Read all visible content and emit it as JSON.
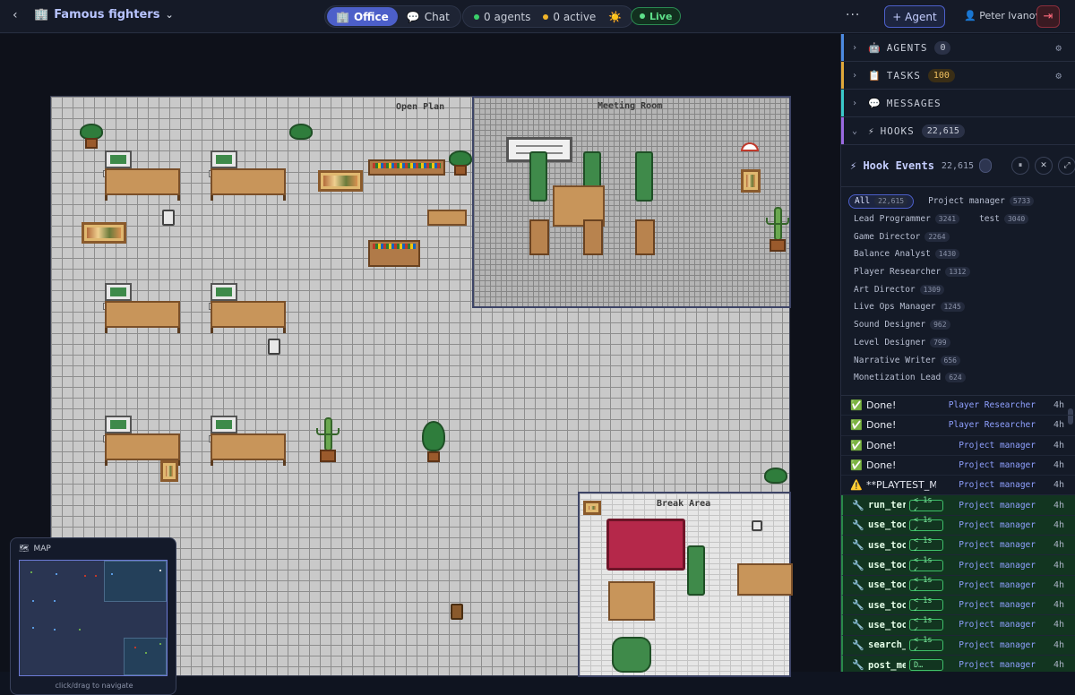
{
  "header": {
    "back_icon": "‹",
    "project_icon": "🏢",
    "project_title": "Famous fighters",
    "modes": [
      {
        "icon": "🏢",
        "label": "Office",
        "active": true
      },
      {
        "icon": "💬",
        "label": "Chat",
        "active": false
      }
    ],
    "agents_stat": "0 agents",
    "active_stat": "0 active",
    "weather_icon": "☀️",
    "live_label": "Live",
    "more_icon": "···",
    "add_agent_label": "+ Agent",
    "user_icon": "👤",
    "user_name": "Peter Ivanov",
    "logout_icon": "⇥"
  },
  "office": {
    "rooms": {
      "open_plan": "Open Plan",
      "meeting": "Meeting Room",
      "break": "Break Area"
    }
  },
  "minimap": {
    "icon": "🗺",
    "title": "MAP",
    "hint": "click/drag to navigate"
  },
  "sidebar": {
    "sections": [
      {
        "icon": "🤖",
        "label": "AGENTS",
        "count": "0",
        "color": "#4c8ae0",
        "gear": true
      },
      {
        "icon": "📋",
        "label": "TASKS",
        "count": "100",
        "color": "#e0a83a",
        "gear": true
      },
      {
        "icon": "💬",
        "label": "MESSAGES",
        "count": "",
        "color": "#3ac9c9",
        "gear": false
      },
      {
        "icon": "⚡",
        "label": "HOOKS",
        "count": "22,615",
        "color": "#9a6ae0",
        "gear": false
      }
    ],
    "hook_events": {
      "title": "⚡ Hook Events",
      "count": "22,615",
      "pause_icon": "⏸",
      "close_icon": "✕",
      "expand_icon": "⤢"
    },
    "filters": [
      [
        {
          "label": "All",
          "count": "22,615",
          "active": true
        },
        {
          "label": "Project manager",
          "count": "5733"
        }
      ],
      [
        {
          "label": "Lead Programmer",
          "count": "3241"
        },
        {
          "label": "test",
          "count": "3040"
        }
      ],
      [
        {
          "label": "Game Director",
          "count": "2264"
        }
      ],
      [
        {
          "label": "Balance Analyst",
          "count": "1430"
        }
      ],
      [
        {
          "label": "Player Researcher",
          "count": "1312"
        }
      ],
      [
        {
          "label": "Art Director",
          "count": "1309"
        }
      ],
      [
        {
          "label": "Live Ops Manager",
          "count": "1245"
        }
      ],
      [
        {
          "label": "Sound Designer",
          "count": "962"
        }
      ],
      [
        {
          "label": "Level Designer",
          "count": "799"
        }
      ],
      [
        {
          "label": "Narrative Writer",
          "count": "656"
        }
      ],
      [
        {
          "label": "Monetization Lead",
          "count": "624"
        }
      ]
    ],
    "events": [
      {
        "icon": "✅",
        "text": "Done!",
        "agent": "Player Researcher",
        "time": "4h",
        "tool": false
      },
      {
        "icon": "✅",
        "text": "Done!",
        "agent": "Player Researcher",
        "time": "4h",
        "tool": false
      },
      {
        "icon": "✅",
        "text": "Done!",
        "agent": "Project manager",
        "time": "4h",
        "tool": false
      },
      {
        "icon": "✅",
        "text": "Done!",
        "agent": "Project manager",
        "time": "4h",
        "tool": false
      },
      {
        "icon": "⚠️",
        "text": "**PLAYTEST_M…",
        "agent": "Project manager",
        "time": "4h",
        "tool": false
      },
      {
        "icon": "🔧",
        "text": "run_ter",
        "dur": "< 1s ✓",
        "agent": "Project manager",
        "time": "4h",
        "tool": true
      },
      {
        "icon": "🔧",
        "text": "use_too",
        "dur": "< 1s ✓",
        "agent": "Project manager",
        "time": "4h",
        "tool": true
      },
      {
        "icon": "🔧",
        "text": "use_too",
        "dur": "< 1s ✓",
        "agent": "Project manager",
        "time": "4h",
        "tool": true
      },
      {
        "icon": "🔧",
        "text": "use_too",
        "dur": "< 1s ✓",
        "agent": "Project manager",
        "time": "4h",
        "tool": true
      },
      {
        "icon": "🔧",
        "text": "use_too",
        "dur": "< 1s ✓",
        "agent": "Project manager",
        "time": "4h",
        "tool": true
      },
      {
        "icon": "🔧",
        "text": "use_too",
        "dur": "< 1s ✓",
        "agent": "Project manager",
        "time": "4h",
        "tool": true
      },
      {
        "icon": "🔧",
        "text": "use_too",
        "dur": "< 1s ✓",
        "agent": "Project manager",
        "time": "4h",
        "tool": true
      },
      {
        "icon": "🔧",
        "text": "search_",
        "dur": "< 1s ✓",
        "agent": "Project manager",
        "time": "4h",
        "tool": true
      },
      {
        "icon": "🔧",
        "text": "post_message",
        "dur": "D…",
        "agent": "Project manager",
        "time": "4h",
        "tool": true
      }
    ]
  }
}
